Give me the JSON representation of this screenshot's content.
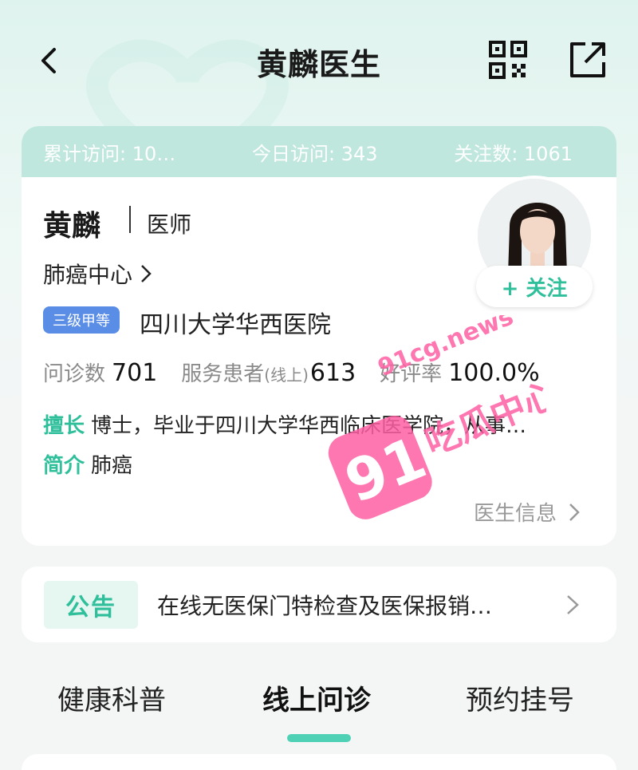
{
  "nav": {
    "title": "黄麟医生",
    "back_icon": "back-arrow-icon",
    "qr_icon": "qr-code-icon",
    "share_icon": "share-icon"
  },
  "stats": {
    "total_visits": "累计访问: 10…",
    "today_visits": "今日访问: 343",
    "followers": "关注数: 1061"
  },
  "doctor": {
    "name": "黄麟",
    "title": "医师",
    "department": "肺癌中心",
    "grade": "三级甲等",
    "hospital": "四川大学华西医院",
    "follow_label": "+ 关注"
  },
  "metrics": {
    "consult_label": "问诊数",
    "consult_value": "701",
    "patients_label": "服务患者",
    "patients_sub": "(线上)",
    "patients_value": "613",
    "rating_label": "好评率",
    "rating_value": "100.0%"
  },
  "profile": {
    "specialty_label": "擅长",
    "specialty_text": "博士，毕业于四川大学华西临床医学院，从事…",
    "intro_label": "简介",
    "intro_text": "肺癌"
  },
  "doctor_info_link": "医生信息",
  "notice": {
    "tag": "公告",
    "text": "在线无医保门特检查及医保报销…"
  },
  "tabs": [
    {
      "label": "健康科普",
      "active": false
    },
    {
      "label": "线上问诊",
      "active": true
    },
    {
      "label": "预约挂号",
      "active": false
    }
  ],
  "watermark": {
    "site": "91cg.news",
    "brand": "91",
    "slogan": "吃瓜中心"
  },
  "colors": {
    "accent": "#2fbf9b",
    "stats_bar": "#bfe7dd",
    "grade_badge": "#5a8de6",
    "watermark": "#ff5fa2"
  }
}
